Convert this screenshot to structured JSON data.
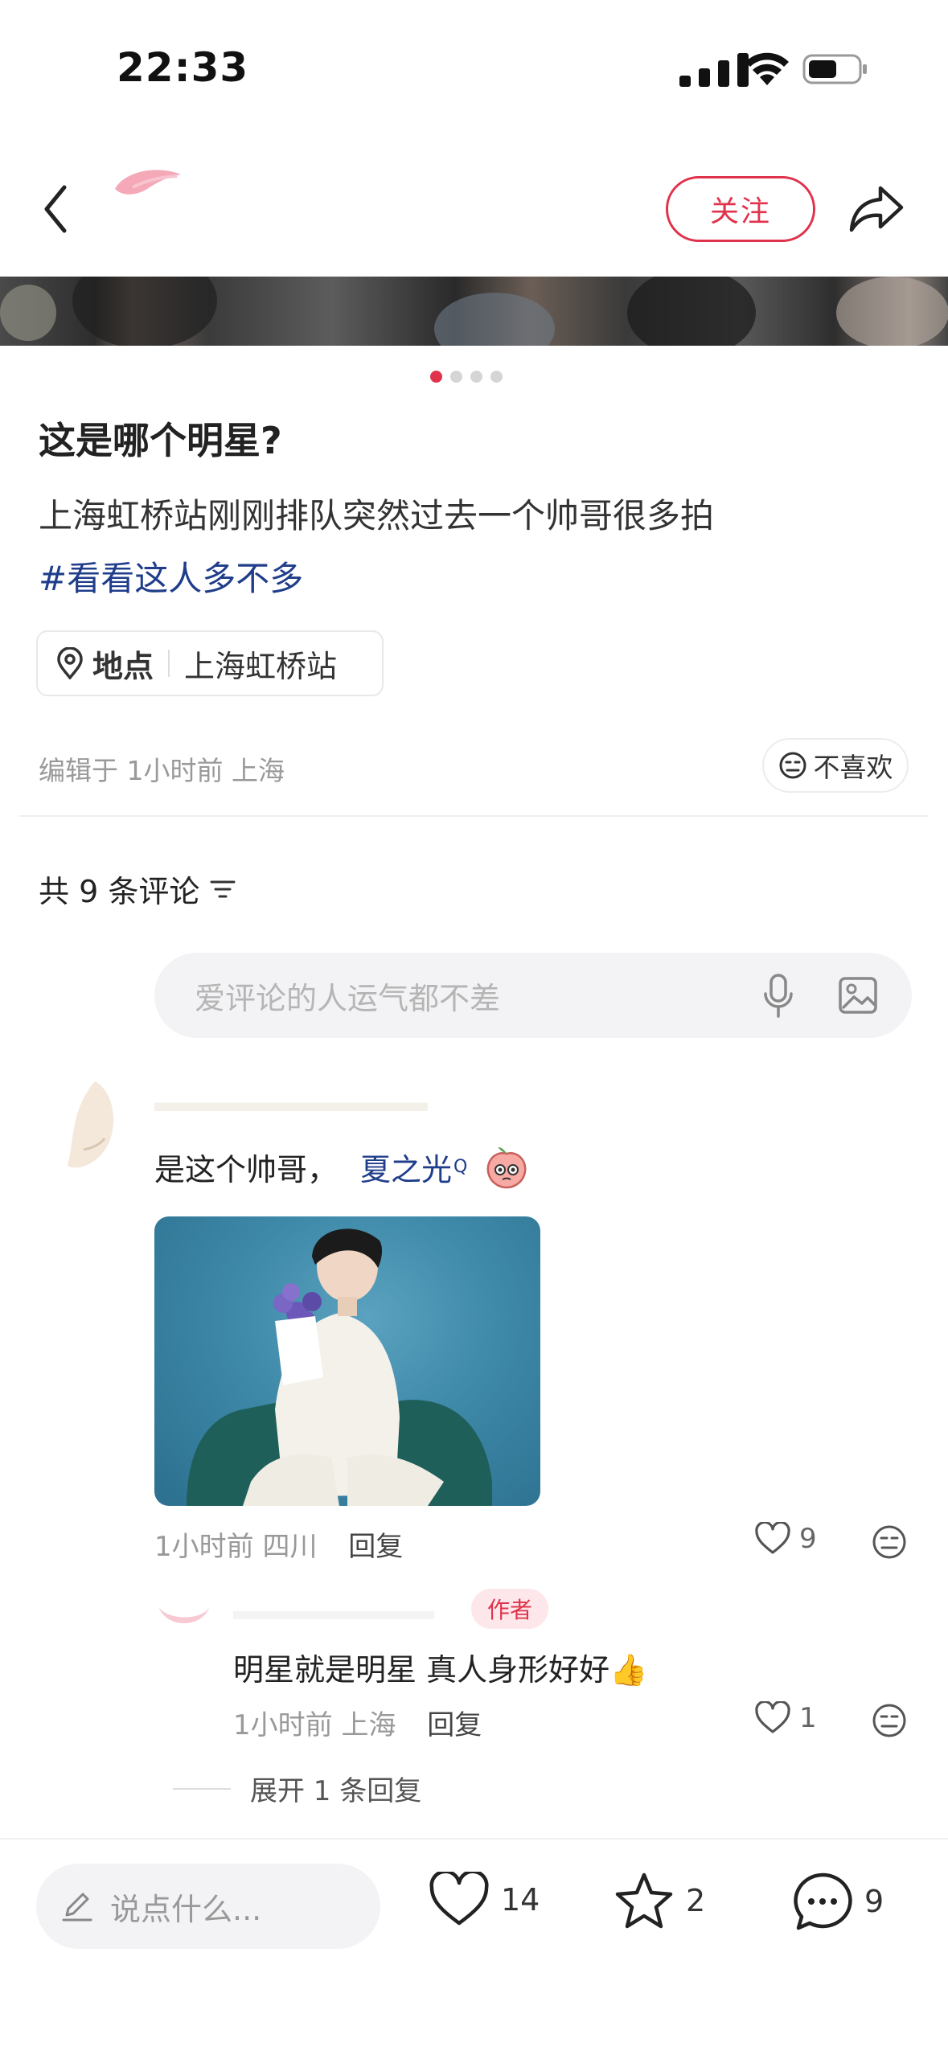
{
  "status_bar": {
    "time": "22:33"
  },
  "header": {
    "follow_label": "关注"
  },
  "carousel": {
    "total": 4,
    "active": 1
  },
  "post": {
    "title": "这是哪个明星?",
    "description": "上海虹桥站刚刚排队突然过去一个帅哥很多拍",
    "hashtag": "#看看这人多不多",
    "location_label": "地点",
    "location_value": "上海虹桥站",
    "edited": "编辑于 1小时前 上海",
    "dislike_label": "不喜欢"
  },
  "comments": {
    "count_label": "共 9 条评论",
    "input_placeholder": "爱评论的人运气都不差",
    "items": [
      {
        "text": "是这个帅哥，",
        "mention": "夏之光",
        "mention_mark": "Q",
        "meta_time_loc": "1小时前 四川",
        "reply_label": "回复",
        "likes": "9",
        "replies": [
          {
            "author_badge": "作者",
            "text": "明星就是明星 真人身形好好👍",
            "meta_time_loc": "1小时前 上海",
            "reply_label": "回复",
            "likes": "1"
          }
        ],
        "expand_label": "展开 1 条回复"
      }
    ]
  },
  "bottom_bar": {
    "input_placeholder": "说点什么...",
    "likes": "14",
    "favorites": "2",
    "comments": "9"
  },
  "colors": {
    "accent": "#e0334b",
    "link": "#1f3d8a"
  }
}
